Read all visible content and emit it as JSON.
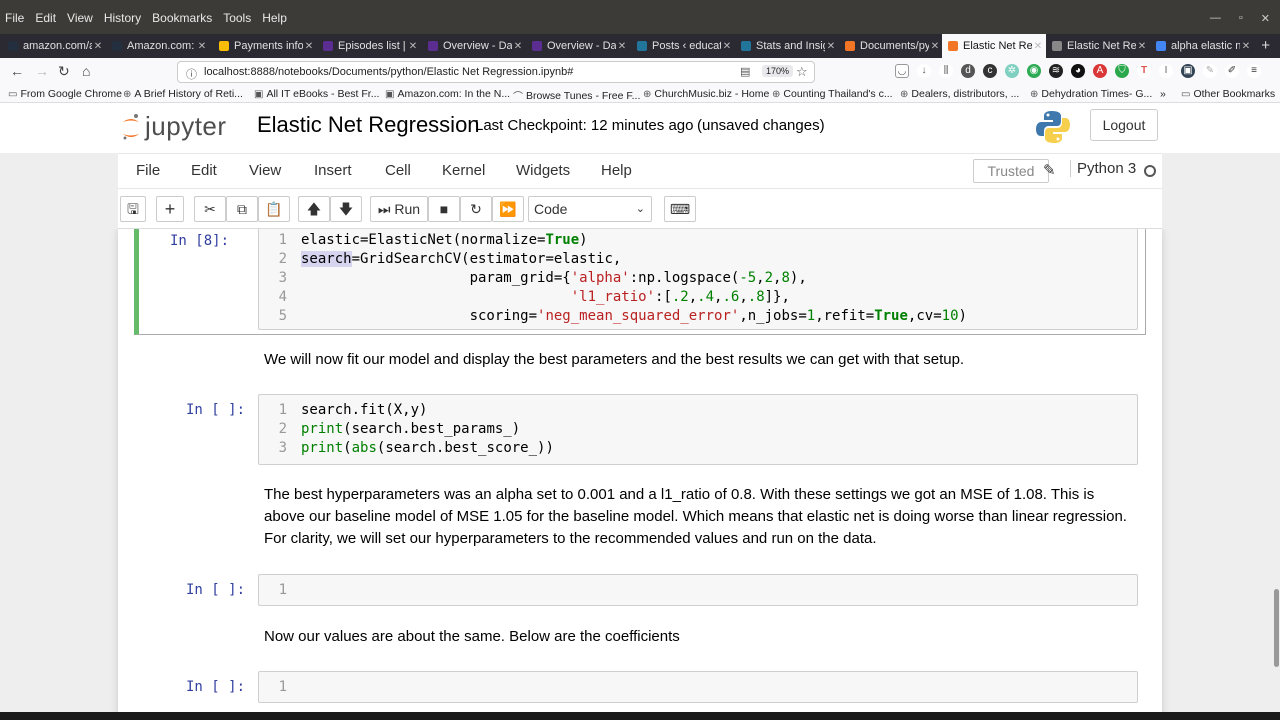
{
  "os_menu": [
    "File",
    "Edit",
    "View",
    "History",
    "Bookmarks",
    "Tools",
    "Help"
  ],
  "tabs": [
    {
      "label": "amazon.com/a",
      "color": "#232f3e"
    },
    {
      "label": "Amazon.com: L",
      "color": "#232f3e"
    },
    {
      "label": "Payments info",
      "color": "#fbbc04"
    },
    {
      "label": "Episodes list | A",
      "color": "#5b2d90"
    },
    {
      "label": "Overview - Das",
      "color": "#5b2d90"
    },
    {
      "label": "Overview - Das",
      "color": "#5b2d90"
    },
    {
      "label": "Posts ‹ educati",
      "color": "#21759b"
    },
    {
      "label": "Stats and Insig",
      "color": "#21759b"
    },
    {
      "label": "Documents/py",
      "color": "#f37626"
    },
    {
      "label": "Elastic Net Re",
      "color": "#f37626",
      "active": true
    },
    {
      "label": "Elastic Net Re",
      "color": "#888888"
    },
    {
      "label": "alpha elastic ne",
      "color": "#4285f4"
    }
  ],
  "nav": {
    "url": "localhost:8888/notebooks/Documents/python/Elastic Net Regression.ipynb#",
    "zoom": "170%"
  },
  "bookmarks": [
    "From Google Chrome",
    "A Brief History of Reti...",
    "All IT eBooks - Best Fr...",
    "Amazon.com: In the N...",
    "Browse Tunes - Free F...",
    "ChurchMusic.biz - Home",
    "Counting Thailand's c...",
    "Dealers, distributors, ...",
    "Dehydration Times- G...",
    "»",
    "Other Bookmarks"
  ],
  "jupyter": {
    "logo_text": "jupyter",
    "title": "Elastic Net Regression",
    "checkpoint": "Last Checkpoint: 12 minutes ago",
    "unsaved": "(unsaved changes)",
    "logout": "Logout",
    "menu": [
      "File",
      "Edit",
      "View",
      "Insert",
      "Cell",
      "Kernel",
      "Widgets",
      "Help"
    ],
    "trusted": "Trusted",
    "kernel": "Python 3",
    "run_label": "Run",
    "cell_type": "Code"
  },
  "cells": {
    "c1_prompt": "In [8]:",
    "c2_prompt": "In [ ]:",
    "c3_prompt": "In [ ]:",
    "c4_prompt": "In [ ]:",
    "md1": "We will now fit our model and display the best parameters and the best results we can get with that setup.",
    "md2": "The best hyperparameters was an alpha set to 0.001 and a l1_ratio of 0.8. With these settings we got an MSE of 1.08. This is above our baseline model of MSE 1.05 for the baseline model. Which means that elastic net is doing worse than linear regression. For clarity, we will set our hyperparameters to the recommended values and run on the data.",
    "md3": "Now our values are about the same. Below are the coefficients"
  }
}
